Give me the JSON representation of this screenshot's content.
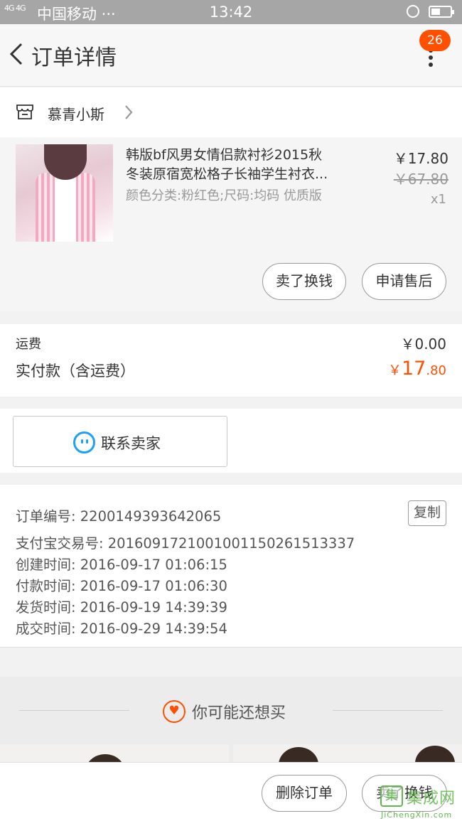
{
  "status_bar": {
    "signal": "4G 4G",
    "carrier": "中国移动 ···",
    "time": "13:42"
  },
  "nav": {
    "title": "订单详情",
    "badge_count": "26"
  },
  "shop": {
    "name": "慕青小斯"
  },
  "product": {
    "title_line1": "韩版bf风男女情侣款衬衫2015秋",
    "title_line2": "冬装原宿宽松格子长袖学生衬衣...",
    "spec": "颜色分类:粉红色;尺码:均码 优质版",
    "price": "￥17.80",
    "original_price": "￥67.80",
    "quantity": "x1",
    "actions": {
      "sell": "卖了换钱",
      "after_sale": "申请售后"
    }
  },
  "fee": {
    "shipping_label": "运费",
    "shipping_value": "￥0.00",
    "paid_label": "实付款（含运费）",
    "paid_currency": "￥",
    "paid_integer": "17",
    "paid_decimal": ".80"
  },
  "contact": {
    "label": "联系卖家"
  },
  "order_info": {
    "order_no": "订单编号: 2200149393642065",
    "copy_label": "复制",
    "alipay_no": "支付宝交易号: 2016091721001001150261513337",
    "created": "创建时间: 2016-09-17 01:06:15",
    "paid": "付款时间: 2016-09-17 01:06:30",
    "shipped": "发货时间: 2016-09-19 14:39:39",
    "completed": "成交时间: 2016-09-29 14:39:54"
  },
  "recommend": {
    "label": "你可能还想买"
  },
  "bottom_bar": {
    "delete_label": "删除订单",
    "sell_label": "卖了换钱"
  },
  "watermark": {
    "logo": "集",
    "brand": "集成网",
    "url": "JiChengXin.com"
  },
  "colors": {
    "accent": "#ff5000",
    "contact_blue": "#1ea1f3",
    "watermark_green": "#5fb84b"
  }
}
